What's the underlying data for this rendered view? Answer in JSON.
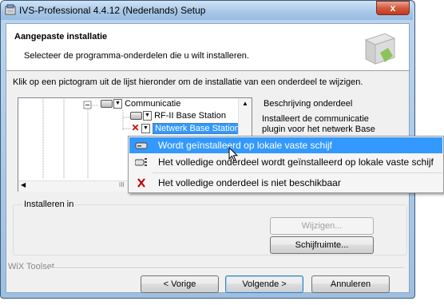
{
  "window": {
    "title": "IVS-Professional 4.4.12 (Nederlands) Setup",
    "close_label": "x"
  },
  "banner": {
    "title": "Aangepaste installatie",
    "subtitle": "Selecteer de programma-onderdelen die u wilt installeren."
  },
  "instruction": "Klik op een pictogram uit de lijst hieronder om de installatie van een onderdeel te wijzigen.",
  "tree": {
    "items": [
      {
        "label": "Communicatie",
        "state": "local"
      },
      {
        "label": "RF-II Base Station",
        "state": "local"
      },
      {
        "label": "Netwerk Base Station",
        "state": "unavailable",
        "selected": true
      }
    ]
  },
  "description": {
    "legend": "Beschrijving onderdeel",
    "line1": "Installeert de communicatie",
    "line2": "plugin voor het netwerk Base"
  },
  "install_in": {
    "legend": "Installeren in",
    "change_label": "Wijzigen...",
    "diskspace_label": "Schijfruimte..."
  },
  "footer": {
    "brand": "WiX Toolset",
    "back_label": "< Vorige",
    "next_label": "Volgende >",
    "cancel_label": "Annuleren"
  },
  "menu": {
    "items": [
      {
        "label": "Wordt geïnstalleerd op lokale vaste schijf",
        "icon": "hard-drive-icon",
        "highlighted": true
      },
      {
        "label": "Het volledige onderdeel wordt geïnstalleerd op lokale vaste schijf",
        "icon": "hard-drive-tree-icon",
        "highlighted": false
      },
      {
        "label": "Het volledige onderdeel is niet beschikbaar",
        "icon": "red-x-icon",
        "highlighted": false
      }
    ]
  },
  "colors": {
    "selection": "#3399ff",
    "unavailable": "#cc0000"
  }
}
